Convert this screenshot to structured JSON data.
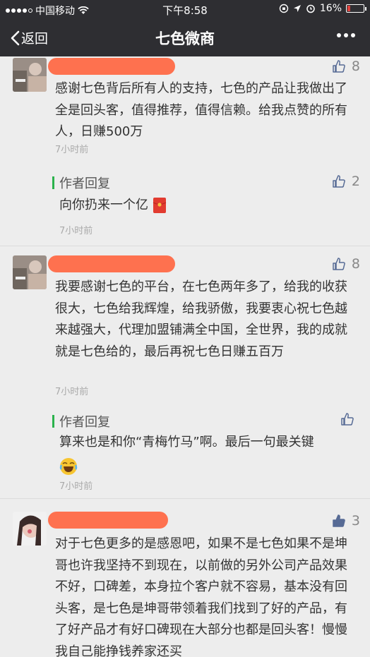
{
  "status_bar": {
    "carrier": "中国移动",
    "time": "下午8:58",
    "battery": "16%"
  },
  "nav": {
    "back_label": "返回",
    "title": "七色微商",
    "more_icon": "more-icon"
  },
  "comments": [
    {
      "likes": "8",
      "text": "感谢七色背后所有人的支持，七色的产品让我做出了全是回头客，值得推荐，值得信赖。给我点赞的所有人，日赚500万",
      "time": "7小时前",
      "reply": {
        "label": "作者回复",
        "likes": "2",
        "text": "向你扔来一个亿",
        "time": "7小时前"
      }
    },
    {
      "likes": "8",
      "text": "我要感谢七色的平台，在七色两年多了，给我的收获很大，七色给我辉煌，给我骄傲，我要衷心祝七色越来越强大，代理加盟铺满全中国，全世界，我的成就就是七色给的，最后再祝七色日赚五百万",
      "time": "7小时前",
      "reply": {
        "label": "作者回复",
        "likes": "",
        "text": "算来也是和你“青梅竹马”啊。最后一句最关键",
        "time": "7小时前"
      }
    },
    {
      "likes": "3",
      "text": "对于七色更多的是感恩吧，如果不是七色如果不是坤哥也许我坚持不到现在，以前做的另外公司产品效果不好，口碑差，本身拉个客户就不容易，基本没有回头客，是七色是坤哥带领着我们找到了好的产品，有了好产品才有好口碑现在大部分也都是回头客！慢慢我自己能挣钱养家还买"
    }
  ],
  "colors": {
    "bar": "#2e2e32",
    "accent_green": "#2bb24c",
    "link_blue": "#576b95",
    "redaction": "#ff6a47"
  }
}
